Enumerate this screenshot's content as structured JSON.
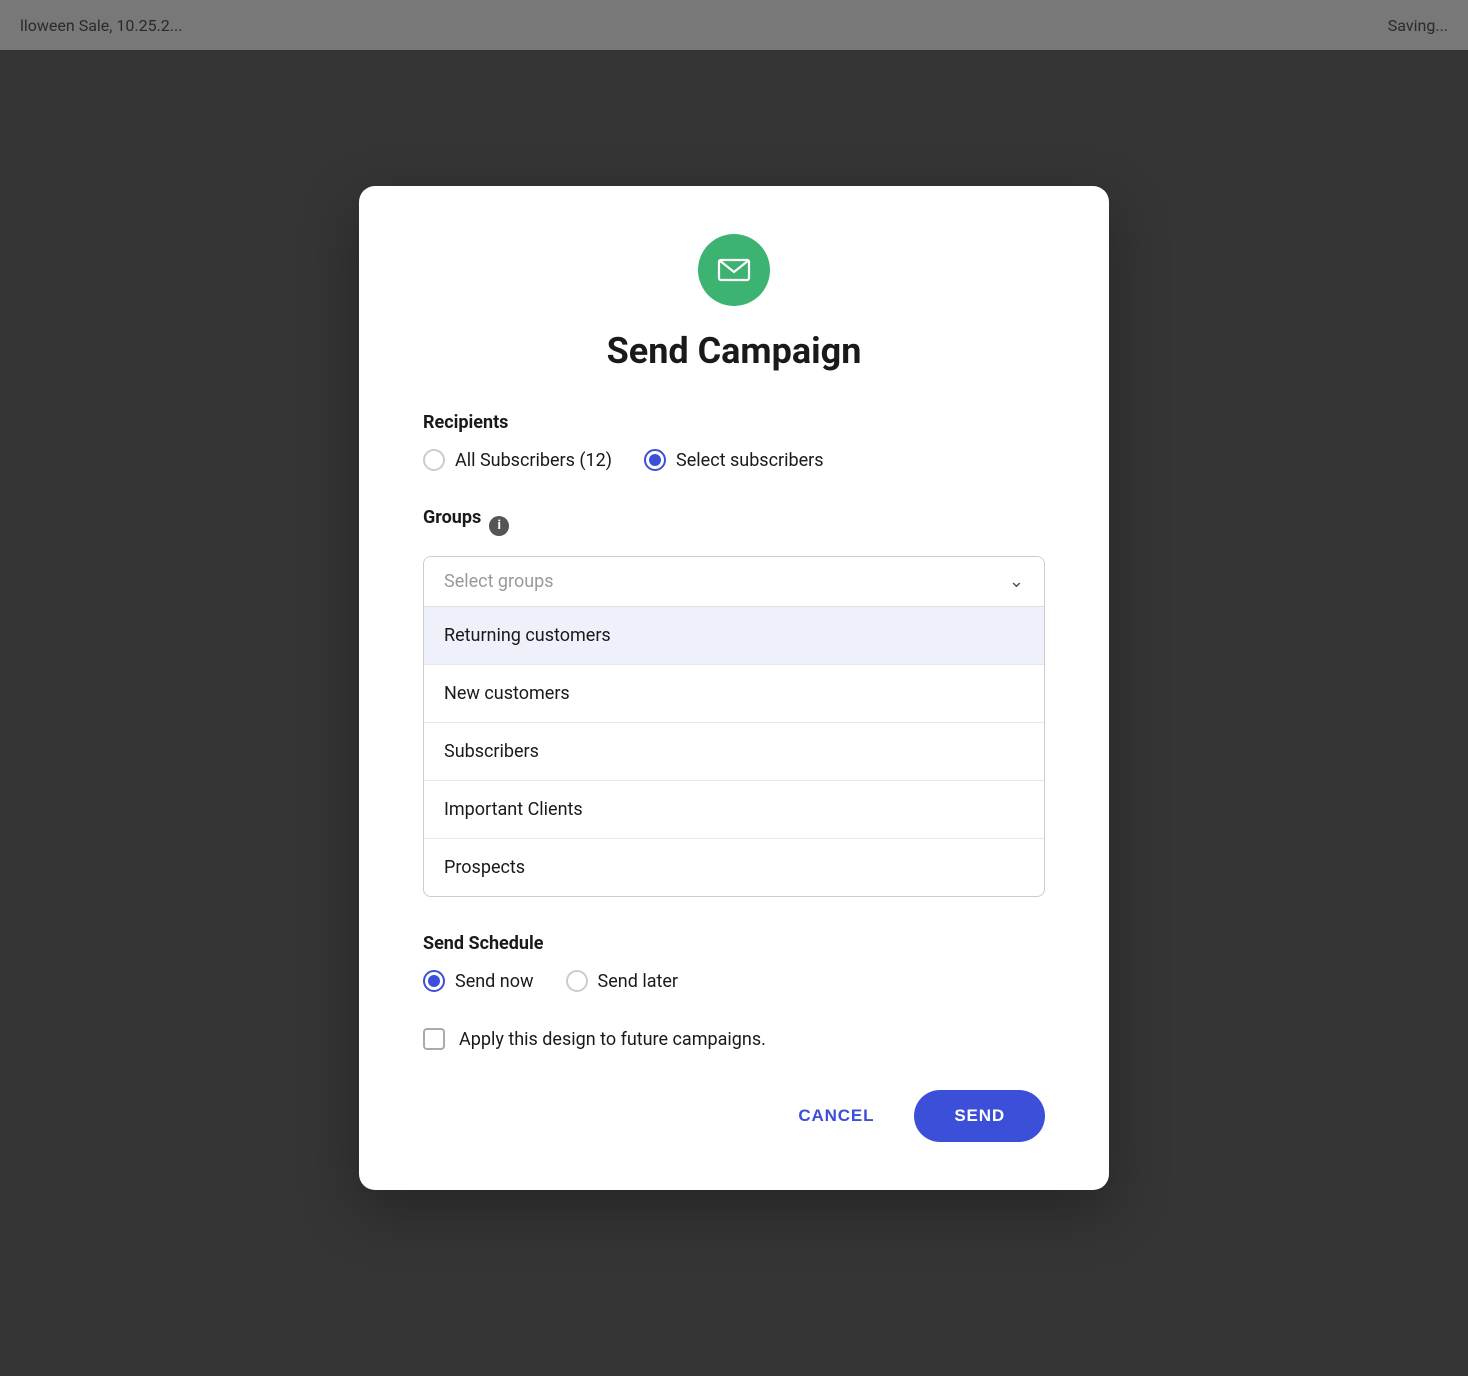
{
  "background": {
    "top_bar_text": "lloween Sale, 10.25.2...",
    "saving_text": "Saving..."
  },
  "modal": {
    "icon_alt": "email-icon",
    "title": "Send Campaign",
    "recipients": {
      "label": "Recipients",
      "options": [
        {
          "id": "all",
          "label": "All Subscribers (12)",
          "selected": false
        },
        {
          "id": "select",
          "label": "Select subscribers",
          "selected": true
        }
      ]
    },
    "groups": {
      "label": "Groups",
      "placeholder": "Select groups",
      "is_open": true,
      "items": [
        {
          "id": "returning",
          "label": "Returning customers",
          "highlighted": true
        },
        {
          "id": "new",
          "label": "New customers",
          "highlighted": false
        },
        {
          "id": "subscribers",
          "label": "Subscribers",
          "highlighted": false
        },
        {
          "id": "important",
          "label": "Important Clients",
          "highlighted": false
        },
        {
          "id": "prospects",
          "label": "Prospects",
          "highlighted": false
        }
      ]
    },
    "schedule": {
      "label": "Send Schedule",
      "options": [
        {
          "id": "now",
          "label": "Send now",
          "selected": true
        },
        {
          "id": "later",
          "label": "Send later",
          "selected": false
        }
      ]
    },
    "checkbox": {
      "label": "Apply this design to future campaigns.",
      "checked": false
    },
    "footer": {
      "cancel_label": "CANCEL",
      "send_label": "SEND"
    }
  },
  "colors": {
    "primary": "#3b4fd8",
    "green": "#3cb371",
    "selected_radio": "#3b4fd8"
  }
}
